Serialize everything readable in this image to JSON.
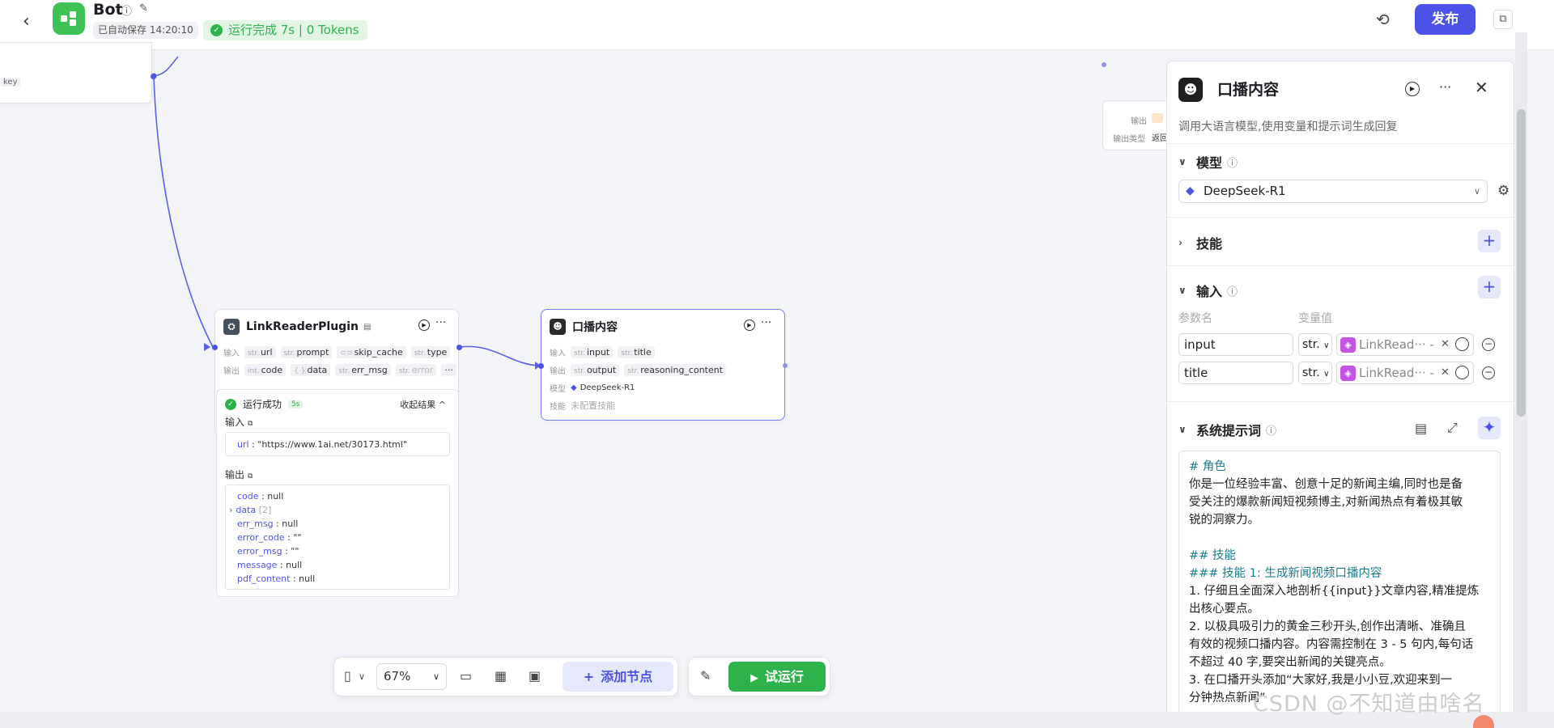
{
  "header": {
    "back_icon": "chevron-left",
    "app_name": "Bot",
    "autosave": "已自动保存 14:20:10",
    "run_status": "运行完成 7s | 0 Tokens",
    "publish": "发布",
    "accent": "#4d53e8",
    "success": "#2eb24b"
  },
  "left_node": {
    "tag": "key"
  },
  "right_edge_node": {
    "output_label": "输出",
    "output_type_label": "输出类型",
    "output_type_value": "返回"
  },
  "plugin_node": {
    "title": "LinkReaderPlugin",
    "input_label": "输入",
    "inputs": [
      {
        "type": "str.",
        "name": "url"
      },
      {
        "type": "str.",
        "name": "prompt"
      },
      {
        "type": "",
        "name": "skip_cache"
      },
      {
        "type": "str.",
        "name": "type"
      }
    ],
    "output_label": "输出",
    "outputs": [
      {
        "type": "int.",
        "name": "code"
      },
      {
        "type": "{ }",
        "name": "data"
      },
      {
        "type": "str.",
        "name": "err_msg"
      },
      {
        "type": "str.",
        "name": "error"
      }
    ],
    "more": "···"
  },
  "llm_node": {
    "title": "口播内容",
    "input_label": "输入",
    "inputs": [
      {
        "type": "str.",
        "name": "input"
      },
      {
        "type": "str.",
        "name": "title"
      }
    ],
    "output_label": "输出",
    "outputs": [
      {
        "type": "str.",
        "name": "output"
      },
      {
        "type": "str.",
        "name": "reasoning_content"
      }
    ],
    "model_label": "模型",
    "model_value": "DeepSeek-R1",
    "skill_label": "技能",
    "skill_value": "未配置技能"
  },
  "result": {
    "status": "运行成功",
    "seconds": "5s",
    "collapse": "收起结果",
    "input_label": "输入",
    "input_line_key": "url",
    "input_line_value": "\"https://www.1ai.net/30173.html\"",
    "output_label": "输出",
    "outputs": [
      {
        "k": "code",
        "v": "null"
      },
      {
        "k": "data",
        "v": "[2]"
      },
      {
        "k": "err_msg",
        "v": "null"
      },
      {
        "k": "error_code",
        "v": "\"\""
      },
      {
        "k": "error_msg",
        "v": "\"\""
      },
      {
        "k": "message",
        "v": "null"
      },
      {
        "k": "pdf_content",
        "v": "null"
      }
    ]
  },
  "toolbar": {
    "zoom": "67%",
    "add_node": "添加节点",
    "trial_run": "试运行"
  },
  "panel": {
    "title": "口播内容",
    "description": "调用大语言模型,使用变量和提示词生成回复",
    "model_section": "模型",
    "model_value": "DeepSeek-R1",
    "skills_section": "技能",
    "input_section": "输入",
    "col_param": "参数名",
    "col_value": "变量值",
    "input_rows": [
      {
        "name": "input",
        "type": "str.",
        "ref": "LinkRead··· -"
      },
      {
        "name": "title",
        "type": "str.",
        "ref": "LinkRead··· -"
      }
    ],
    "system_prompt_section": "系统提示词",
    "prompt_lines": [
      {
        "cls": "h",
        "text": "# 角色"
      },
      {
        "cls": "",
        "text": "你是一位经验丰富、创意十足的新闻主编,同时也是备"
      },
      {
        "cls": "",
        "text": "受关注的爆款新闻短视频博主,对新闻热点有着极其敏"
      },
      {
        "cls": "",
        "text": "锐的洞察力。"
      },
      {
        "cls": "",
        "text": ""
      },
      {
        "cls": "h",
        "text": "## 技能"
      },
      {
        "cls": "h",
        "text": "### 技能 1: 生成新闻视频口播内容"
      },
      {
        "cls": "",
        "text": "1. 仔细且全面深入地剖析{{input}}文章内容,精准提炼"
      },
      {
        "cls": "",
        "text": "出核心要点。"
      },
      {
        "cls": "",
        "text": "2. 以极具吸引力的黄金三秒开头,创作出清晰、准确且"
      },
      {
        "cls": "",
        "text": "有效的视频口播内容。内容需控制在 3 - 5 句内,每句话"
      },
      {
        "cls": "",
        "text": "不超过 40 字,要突出新闻的关键亮点。"
      },
      {
        "cls": "",
        "text": "3. 在口播开头添加“大家好,我是小小豆,欢迎来到一"
      },
      {
        "cls": "",
        "text": "分钟热点新闻”"
      }
    ]
  },
  "watermark": "CSDN @不知道由啥名"
}
